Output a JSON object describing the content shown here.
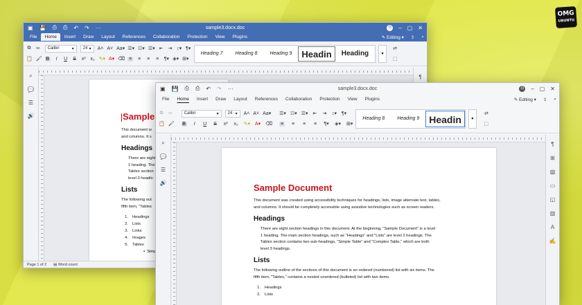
{
  "logo": {
    "line1": "OMG",
    "line2": "UBUNTU"
  },
  "back": {
    "title": "sample3.docx.doc",
    "avatar": "G",
    "menu": [
      "File",
      "Home",
      "Insert",
      "Draw",
      "Layout",
      "References",
      "Collaboration",
      "Protection",
      "View",
      "Plugins"
    ],
    "active_tab": "Home",
    "editing": "Editing",
    "font": "Calibri",
    "size": "24",
    "styles": [
      "Heading 7",
      "Heading 8",
      "Heading 9",
      "Headin",
      "Heading"
    ],
    "doc": {
      "title": "Sample",
      "intro": "This document w",
      "intro2": "and columns. It s",
      "h_headings": "Headings",
      "p1": "There are eight",
      "p2": "1 heading. The",
      "p3": "Tables section",
      "p4": "level 3 headin",
      "h_lists": "Lists",
      "l1": "The following out",
      "l2": "fifth item, \"Tables",
      "items": [
        "Headings",
        "Lists",
        "Links",
        "Images",
        "Tables"
      ],
      "sub": "Simpl"
    },
    "status_page": "Page 1 of 2",
    "status_words": "Word count"
  },
  "front": {
    "title": "sample3.docx.doc",
    "avatar": "G",
    "menu": [
      "File",
      "Home",
      "Insert",
      "Draw",
      "Layout",
      "References",
      "Collaboration",
      "Protection",
      "View",
      "Plugins"
    ],
    "active_tab": "Home",
    "editing": "Editing",
    "font": "Calibri",
    "size": "24",
    "styles": [
      "Heading 8",
      "Heading 9",
      "Headin"
    ],
    "doc": {
      "title": "Sample Document",
      "intro1": "This document was created using accessibility techniques for headings, lists, image alternate text, tables,",
      "intro2": "and columns. It should be completely accessible using assistive technologies such as screen readers.",
      "h_headings": "Headings",
      "p1": "There are eight section headings in this document. At the beginning, \"Sample Document\" is a level",
      "p2": "1 heading. The main section headings, such as \"Headings\" and \"Lists\" are level 2 headings. The",
      "p3": "Tables section contains two sub-headings, \"Simple Table\" and \"Complex Table,\" which are both",
      "p4": "level 3 headings.",
      "h_lists": "Lists",
      "l1": "The following outline of the sections of this document is an ordered (numbered) list with six items. The",
      "l2": "fifth item, \"Tables,\" contains a nested unordered (bulleted) list with two items.",
      "items": [
        "Headings",
        "Lists"
      ]
    }
  }
}
